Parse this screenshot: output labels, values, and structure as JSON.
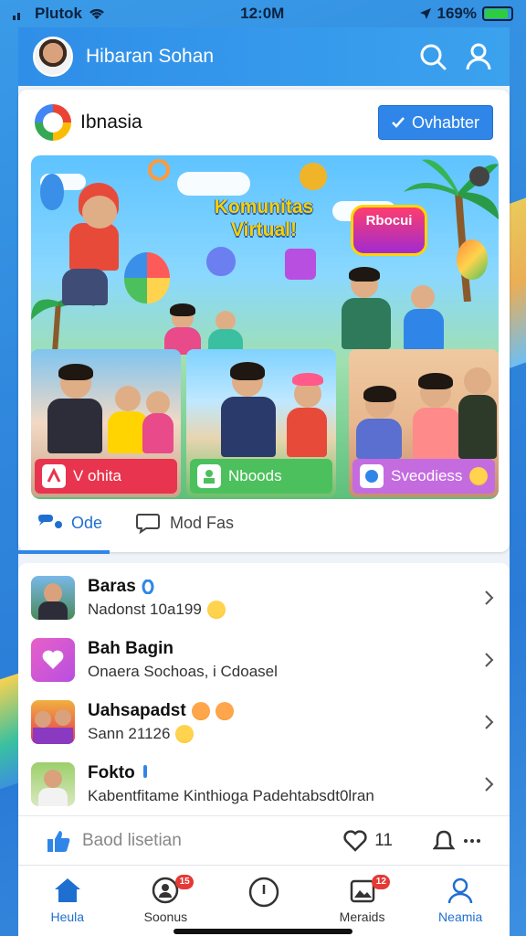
{
  "status_bar": {
    "carrier": "Plutok",
    "time": "12:0M",
    "battery": "169%",
    "battery_level": 0.9
  },
  "header": {
    "title": "Hibaran Sohan"
  },
  "card": {
    "brand": "Ibnasia",
    "follow_label": "Ovhabter",
    "hero": {
      "title": "Komunitas Virtual!",
      "badge": "Rbocui"
    },
    "sub_tiles": [
      {
        "label": "V ohita",
        "color": "#e8344e"
      },
      {
        "label": "Nboods",
        "color": "#4cc05c"
      },
      {
        "label": "Sveodiess",
        "color": "#c46be0"
      }
    ],
    "tabs": [
      {
        "label": "Ode",
        "active": true
      },
      {
        "label": "Mod Fas",
        "active": false
      }
    ]
  },
  "list": {
    "rows": [
      {
        "title": "Baras",
        "subtitle": "Nadonst 10a199"
      },
      {
        "title": "Bah Bagin",
        "subtitle": "Onaera Sochoas, i Cdoasel"
      },
      {
        "title": "Uahsapadst",
        "subtitle": "Sann 21126"
      },
      {
        "title": "Fokto",
        "subtitle": "Kabentfitame Kinthioga Padehtabsdt0lran"
      }
    ]
  },
  "action_bar": {
    "label": "Baod lisetian",
    "like_count": "11"
  },
  "bottom_nav": {
    "items": [
      {
        "label": "Heula",
        "active": true,
        "badge": ""
      },
      {
        "label": "Soonus",
        "active": false,
        "badge": "15"
      },
      {
        "label": "",
        "active": false,
        "badge": ""
      },
      {
        "label": "Meraids",
        "active": false,
        "badge": "12"
      },
      {
        "label": "Neamia",
        "active": true,
        "badge": ""
      }
    ]
  },
  "colors": {
    "accent": "#2f86e8",
    "header": "#3a9be8",
    "badge_red": "#e53935"
  }
}
